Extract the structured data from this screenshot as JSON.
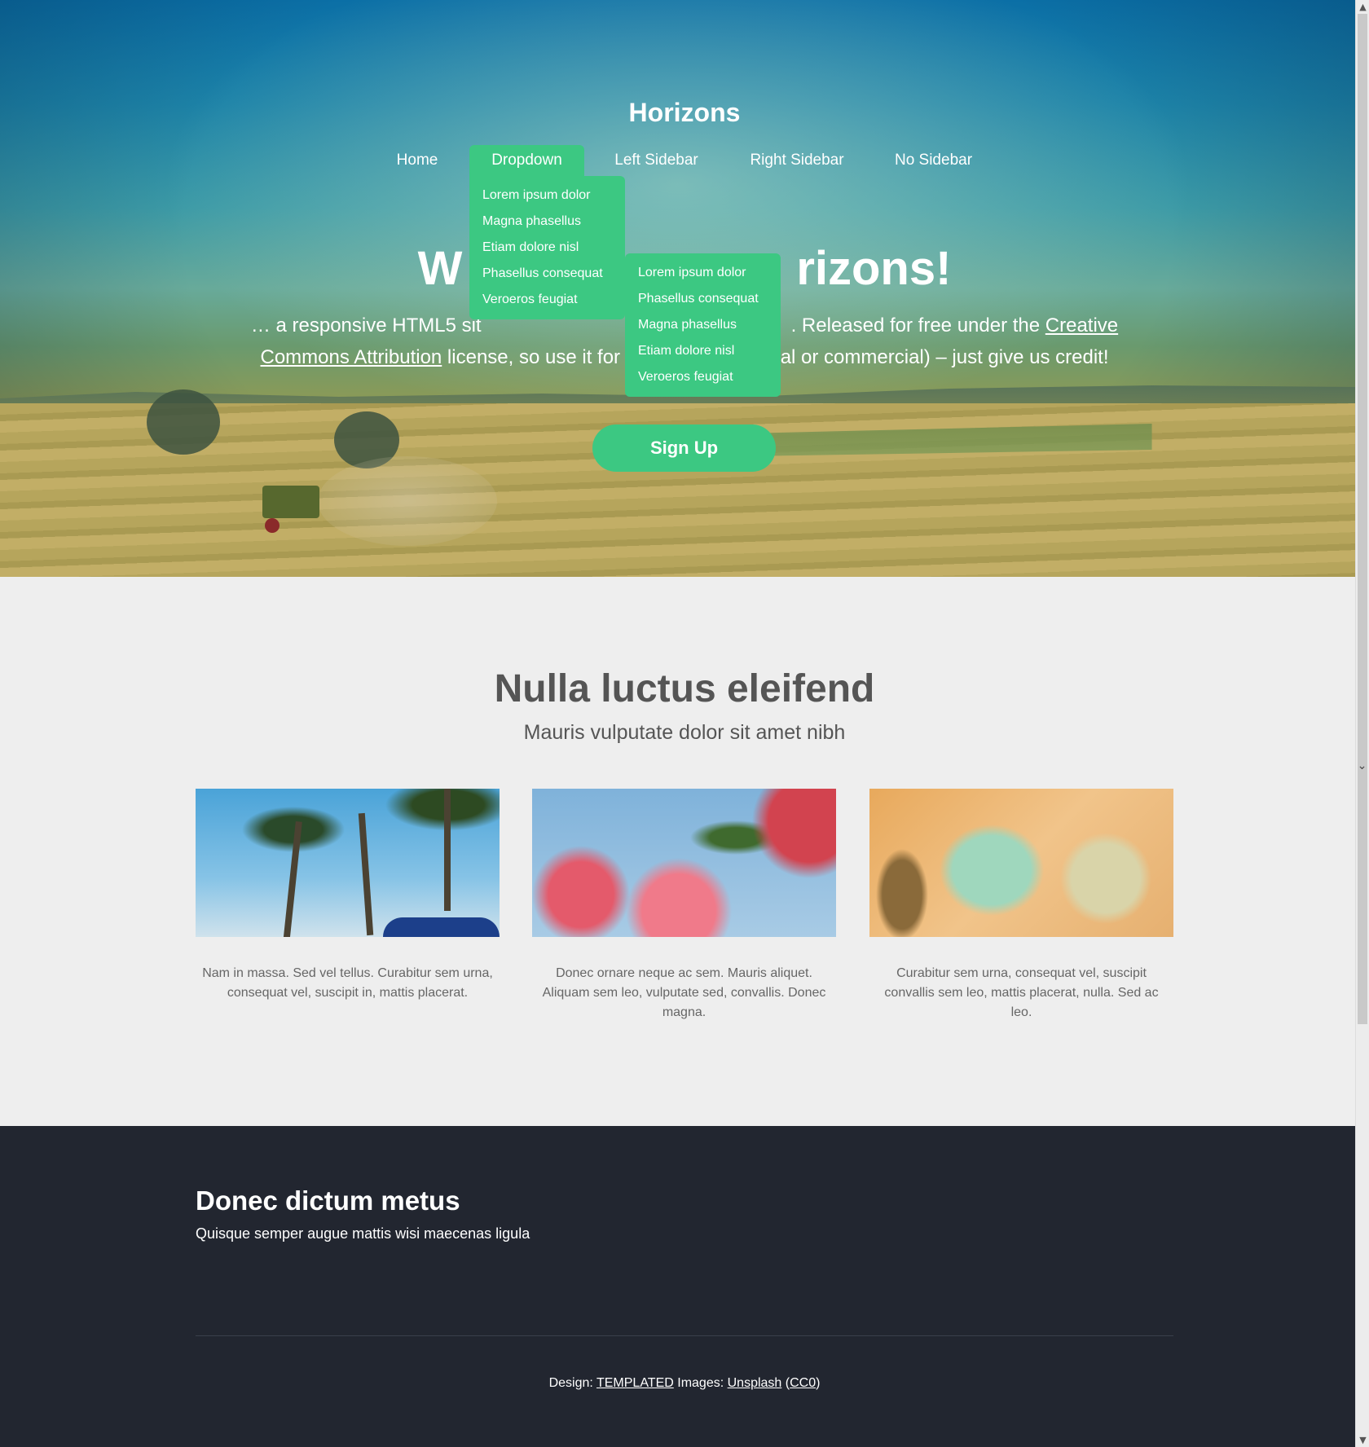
{
  "site": {
    "title": "Horizons"
  },
  "nav": {
    "items": [
      {
        "label": "Home"
      },
      {
        "label": "Dropdown"
      },
      {
        "label": "Left Sidebar"
      },
      {
        "label": "Right Sidebar"
      },
      {
        "label": "No Sidebar"
      }
    ],
    "dropdown": [
      {
        "label": "Lorem ipsum dolor"
      },
      {
        "label": "Magna phasellus"
      },
      {
        "label": "Etiam dolore nisl"
      },
      {
        "label": "Phasellus consequat"
      },
      {
        "label": "Veroeros feugiat"
      }
    ],
    "submenu": [
      {
        "label": "Lorem ipsum dolor"
      },
      {
        "label": "Phasellus consequat"
      },
      {
        "label": "Magna phasellus"
      },
      {
        "label": "Etiam dolore nisl"
      },
      {
        "label": "Veroeros feugiat"
      }
    ]
  },
  "hero": {
    "heading_left": "W",
    "heading_right": "rizons!",
    "text_part1": "… a responsive HTML5 sit",
    "text_part2": ". Released for free under the ",
    "link_creative": "Creative",
    "link_commons": "Commons Attribution",
    "text_part3": " license, so use it for ",
    "text_part4": "al or commercial) – just give us credit!",
    "signup_label": "Sign Up"
  },
  "features": {
    "heading": "Nulla luctus eleifend",
    "subheading": "Mauris vulputate dolor sit amet nibh",
    "cards": [
      {
        "image_name": "palm-trees-image",
        "text": "Nam in massa. Sed vel tellus. Curabitur sem urna, consequat vel, suscipit in, mattis placerat."
      },
      {
        "image_name": "flowers-image",
        "text": "Donec ornare neque ac sem. Mauris aliquet. Aliquam sem leo, vulputate sed, convallis. Donec magna."
      },
      {
        "image_name": "glass-jars-image",
        "text": "Curabitur sem urna, consequat vel, suscipit convallis sem leo, mattis placerat, nulla. Sed ac leo."
      }
    ]
  },
  "footer": {
    "heading": "Donec dictum metus",
    "subheading": "Quisque semper augue mattis wisi maecenas ligula",
    "credits": {
      "design_prefix": "Design: ",
      "design_link": "TEMPLATED",
      "images_prefix": " Images: ",
      "images_link": "Unsplash",
      "license_open": " (",
      "license_link": "CC0",
      "license_close": ")"
    }
  },
  "colors": {
    "accent": "#3cc882",
    "footer_bg": "#222630",
    "body_bg": "#eeeeee"
  }
}
